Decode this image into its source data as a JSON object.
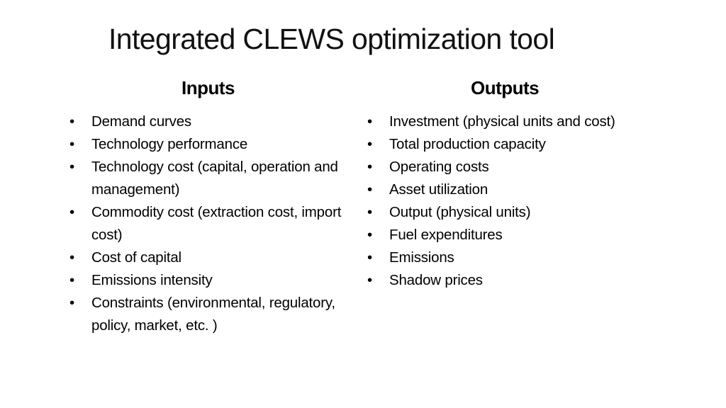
{
  "slide": {
    "title": "Integrated CLEWS optimization tool",
    "inputs": {
      "heading": "Inputs",
      "items": [
        "Demand curves",
        "Technology performance",
        "Technology cost (capital, operation and management)",
        "Commodity cost (extraction cost, import cost)",
        "Cost of capital",
        "Emissions intensity",
        "Constraints (environmental, regulatory, policy, market, etc. )"
      ]
    },
    "outputs": {
      "heading": "Outputs",
      "items": [
        "Investment (physical units and cost)",
        "Total production capacity",
        "Operating costs",
        "Asset utilization",
        "Output (physical units)",
        "Fuel expenditures",
        "Emissions",
        "Shadow prices"
      ]
    },
    "bullet_glyph": "•"
  }
}
